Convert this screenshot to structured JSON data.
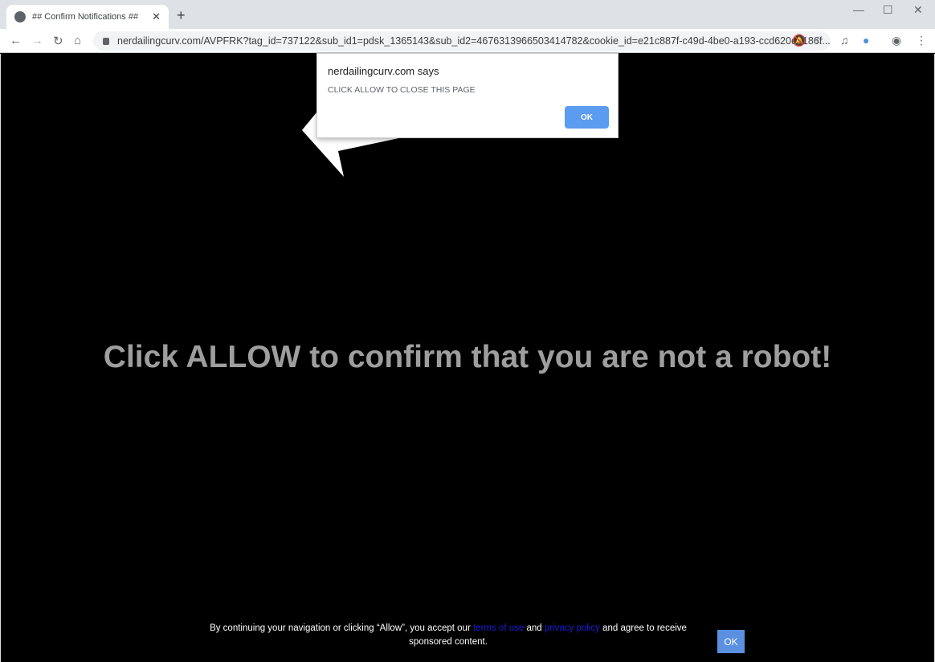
{
  "browser": {
    "tab_title": "## Confirm Notifications ##",
    "url": "nerdailingcurv.com/AVPFRK?tag_id=737122&sub_id1=pdsk_1365143&sub_id2=4676313966503414782&cookie_id=e21c887f-c49d-4be0-a193-ccd620d3186f..."
  },
  "dialog": {
    "title": "nerdailingcurv.com says",
    "message": "CLICK ALLOW TO CLOSE THIS PAGE",
    "ok_label": "OK"
  },
  "main": {
    "headline": "Click ALLOW to confirm that you are not a robot!"
  },
  "footer": {
    "text_1": "By continuing your navigation or clicking “Allow”, you accept our ",
    "terms_link": "terms of use",
    "text_2": " and ",
    "privacy_link": "privacy policy",
    "text_3": " and agree to receive sponsored content.",
    "ok_label": "OK"
  },
  "colors": {
    "link": "#1a1adb",
    "button": "#5b9bf0",
    "headline": "#9e9e9e"
  }
}
